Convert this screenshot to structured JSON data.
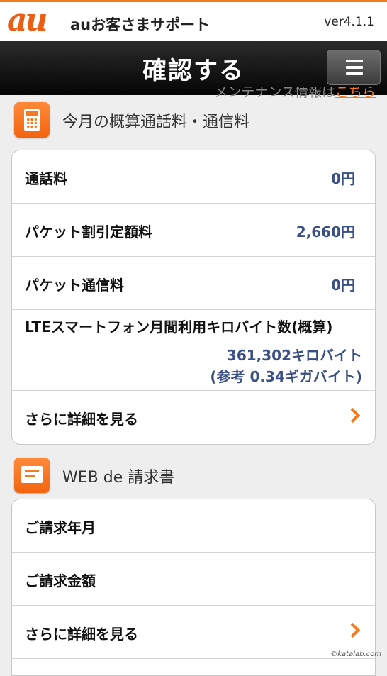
{
  "header": {
    "logo": "au",
    "app_title": "auお客さまサポート",
    "version": "ver4.1.1"
  },
  "navbar": {
    "title": "確認する",
    "menu_icon": "hamburger-menu-icon"
  },
  "notice": {
    "text": "メンテナンス情報は",
    "link": "こちら"
  },
  "charges": {
    "icon": "calculator-icon",
    "title": "今月の概算通話料・通信料",
    "rows": [
      {
        "label": "通話料",
        "value": "0円"
      },
      {
        "label": "パケット割引定額料",
        "value": "2,660円"
      },
      {
        "label": "パケット通信料",
        "value": "0円"
      }
    ],
    "lte": {
      "label": "LTEスマートフォン月間利用キロバイト数(概算)",
      "value_kb": "361,302キロバイト",
      "value_gb": "(参考 0.34ギガバイト)"
    },
    "more_label": "さらに詳細を見る"
  },
  "invoice": {
    "icon": "invoice-icon",
    "title": "WEB de 請求書",
    "rows": [
      {
        "label": "ご請求年月"
      },
      {
        "label": "ご請求金額"
      }
    ],
    "more_label": "さらに詳細を見る"
  },
  "copyright": "©katalab.com",
  "colors": {
    "accent": "#f47a20",
    "value_text": "#3a4f86"
  }
}
